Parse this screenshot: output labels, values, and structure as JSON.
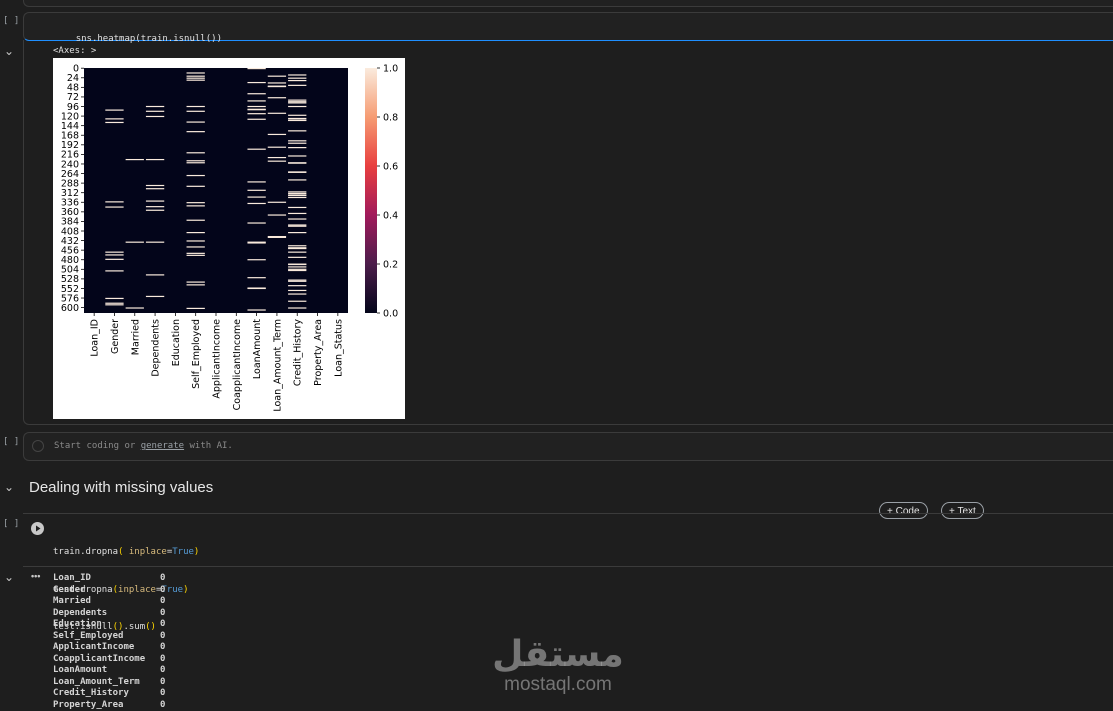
{
  "cells": {
    "heatmap_cell": {
      "exec_label": "[ ]",
      "code": "sns.heatmap(train.isnull())",
      "output_label": "<Axes: >"
    },
    "empty_cell": {
      "exec_label": "[ ]",
      "placeholder_pre": "Start coding or ",
      "placeholder_link": "generate",
      "placeholder_post": " with AI."
    },
    "section": {
      "title": "Dealing with missing values"
    },
    "add_code_label": "+ Code",
    "add_text_label": "+ Text",
    "dropna_cell": {
      "exec_label": "[ ]",
      "lines": [
        "train.dropna( inplace=True)",
        "test.dropna(inplace=True)",
        "test.isnull().sum()"
      ]
    },
    "sum_output": {
      "rows": [
        {
          "name": "Loan_ID",
          "value": "0"
        },
        {
          "name": "Gender",
          "value": "0"
        },
        {
          "name": "Married",
          "value": "0"
        },
        {
          "name": "Dependents",
          "value": "0"
        },
        {
          "name": "Education",
          "value": "0"
        },
        {
          "name": "Self_Employed",
          "value": "0"
        },
        {
          "name": "ApplicantIncome",
          "value": "0"
        },
        {
          "name": "CoapplicantIncome",
          "value": "0"
        },
        {
          "name": "LoanAmount",
          "value": "0"
        },
        {
          "name": "Loan_Amount_Term",
          "value": "0"
        },
        {
          "name": "Credit_History",
          "value": "0"
        },
        {
          "name": "Property_Area",
          "value": "0"
        }
      ]
    }
  },
  "watermark": {
    "arabic": "مستقل",
    "latin": "mostaql.com"
  },
  "chart_data": {
    "type": "heatmap",
    "title": "",
    "xlabel": "",
    "ylabel": "",
    "columns": [
      "Loan_ID",
      "Gender",
      "Married",
      "Dependents",
      "Education",
      "Self_Employed",
      "ApplicantIncome",
      "CoapplicantIncome",
      "LoanAmount",
      "Loan_Amount_Term",
      "Credit_History",
      "Property_Area",
      "Loan_Status"
    ],
    "y_ticks": [
      "0",
      "24",
      "48",
      "72",
      "96",
      "120",
      "144",
      "168",
      "192",
      "216",
      "240",
      "264",
      "288",
      "312",
      "336",
      "360",
      "384",
      "408",
      "432",
      "456",
      "480",
      "504",
      "528",
      "552",
      "576",
      "600"
    ],
    "row_count": 614,
    "colorbar_ticks": [
      "0.0",
      "0.2",
      "0.4",
      "0.6",
      "0.8",
      "1.0"
    ],
    "vmin": 0,
    "vmax": 1,
    "missing_rows": {
      "Gender": [
        104,
        126,
        135,
        334,
        347,
        460,
        467,
        478,
        507,
        576,
        588,
        592
      ],
      "Married": [
        228,
        435,
        600
      ],
      "Dependents": [
        95,
        107,
        120,
        228,
        293,
        301,
        332,
        346,
        355,
        435,
        517,
        571
      ],
      "Self_Employed": [
        11,
        19,
        24,
        29,
        95,
        107,
        134,
        158,
        211,
        231,
        236,
        268,
        295,
        336,
        344,
        380,
        411,
        432,
        447,
        463,
        468,
        535,
        542,
        601
      ],
      "LoanAmount": [
        0,
        35,
        63,
        81,
        95,
        102,
        103,
        113,
        127,
        202,
        284,
        305,
        322,
        338,
        387,
        435,
        437,
        479,
        524,
        550,
        551,
        605
      ],
      "Loan_Amount_Term": [
        19,
        36,
        44,
        45,
        73,
        112,
        165,
        197,
        223,
        232,
        335,
        367,
        421,
        423
      ],
      "Credit_History": [
        16,
        24,
        30,
        42,
        79,
        83,
        86,
        95,
        117,
        125,
        129,
        130,
        156,
        181,
        187,
        198,
        219,
        236,
        237,
        259,
        260,
        279,
        309,
        313,
        317,
        318,
        323,
        348,
        363,
        377,
        392,
        395,
        411,
        444,
        449,
        451,
        460,
        473,
        490,
        491,
        497,
        503,
        506,
        530,
        533,
        544,
        556,
        565,
        583,
        600
      ]
    }
  }
}
